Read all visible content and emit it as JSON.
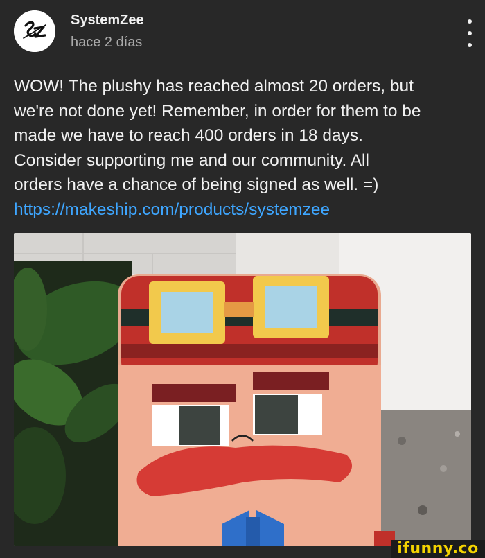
{
  "post": {
    "channel_name": "SystemZee",
    "timestamp": "hace 2 días",
    "avatar_logo_text": "SZ",
    "text": "WOW! The plushy has reached almost 20 orders, but\nwe're not done yet! Remember, in order for them to be\nmade we have to reach 400 orders in 18 days.\nConsider supporting me and our community. All\norders have a chance of being signed as well. =)",
    "link": "https://makeship.com/products/systemzee"
  },
  "menu": {
    "icon": "more-vertical-icon"
  },
  "image": {
    "subject": "plush-toy-photo"
  },
  "watermark": {
    "text": "ifunny.co"
  },
  "colors": {
    "background": "#282828",
    "link": "#3ea6ff",
    "watermark": "#f5d300"
  }
}
